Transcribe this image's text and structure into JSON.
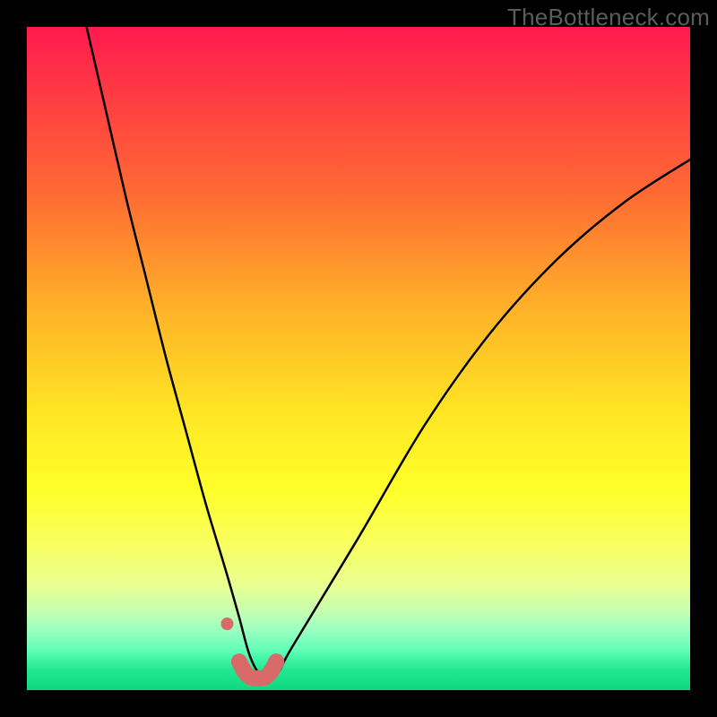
{
  "watermark": "TheBottleneck.com",
  "colors": {
    "page_bg": "#000000",
    "curve_stroke": "#000000",
    "marker_fill": "#d86a6a",
    "marker_stroke": "#d86a6a"
  },
  "chart_data": {
    "type": "line",
    "title": "",
    "xlabel": "",
    "ylabel": "",
    "xlim": [
      0,
      100
    ],
    "ylim": [
      0,
      100
    ],
    "grid": false,
    "legend": false,
    "note": "No axis ticks or numeric labels are shown; x/y are normalized 0–100. y≈0 is bottom (green), y≈100 is top (red). Values estimated from pixel positions.",
    "series": [
      {
        "name": "bottleneck-curve",
        "kind": "line",
        "x": [
          9,
          12,
          15,
          18,
          21,
          24,
          27,
          30,
          32,
          33.5,
          35,
          36.5,
          38,
          40,
          50,
          60,
          70,
          80,
          90,
          100
        ],
        "y": [
          100,
          87,
          74,
          62,
          50,
          39,
          28,
          18,
          11,
          5.5,
          2.5,
          1.8,
          2.8,
          6.5,
          23,
          40,
          54,
          65,
          73.5,
          80
        ]
      },
      {
        "name": "highlight-band",
        "kind": "scatter",
        "x": [
          32.0,
          32.8,
          33.6,
          34.4,
          35.2,
          36.0,
          36.8,
          37.6
        ],
        "y": [
          4.3,
          2.8,
          2.0,
          1.8,
          1.8,
          2.0,
          2.8,
          4.3
        ]
      },
      {
        "name": "highlight-outlier",
        "kind": "scatter",
        "x": [
          30.2
        ],
        "y": [
          10.0
        ]
      }
    ]
  }
}
